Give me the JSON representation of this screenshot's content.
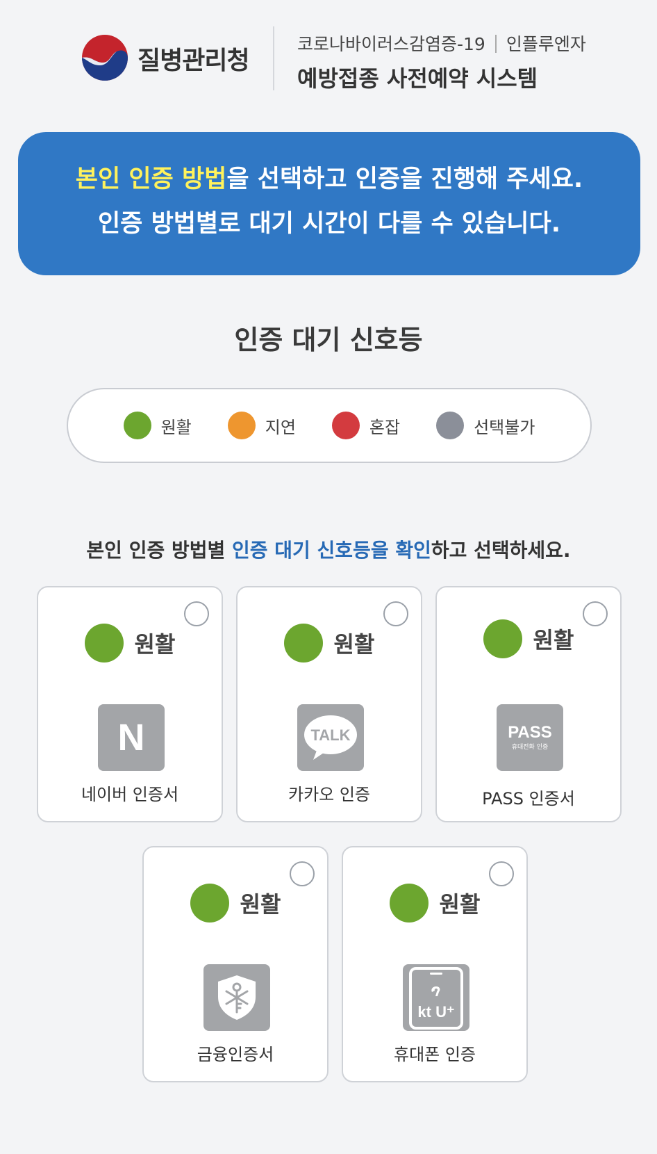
{
  "header": {
    "org_name": "질병관리청",
    "subtitle_left": "코로나바이러스감염증-19",
    "subtitle_right": "인플루엔자",
    "system_title": "예방접종 사전예약 시스템"
  },
  "banner": {
    "line1_highlight": "본인 인증 방법",
    "line1_rest": "을 선택하고 인증을 진행해 주세요.",
    "line2": "인증 방법별로 대기 시간이 다를 수 있습니다."
  },
  "signal": {
    "title": "인증 대기 신호등",
    "legend": [
      {
        "label": "원활",
        "color": "#6ca62f"
      },
      {
        "label": "지연",
        "color": "#ee962f"
      },
      {
        "label": "혼잡",
        "color": "#d33b3f"
      },
      {
        "label": "선택불가",
        "color": "#8b8f99"
      }
    ]
  },
  "guide": {
    "prefix": "본인 인증 방법별 ",
    "highlight": "인증 대기 신호등을 확인",
    "suffix": "하고 선택하세요."
  },
  "methods": [
    {
      "status": "원활",
      "status_color": "#6ca62f",
      "label": "네이버 인증서",
      "icon": "naver-icon",
      "icon_text": "N"
    },
    {
      "status": "원활",
      "status_color": "#6ca62f",
      "label": "카카오 인증",
      "icon": "kakao-talk-icon",
      "icon_text": "TALK"
    },
    {
      "status": "원활",
      "status_color": "#6ca62f",
      "label": "PASS 인증서",
      "icon": "pass-icon",
      "icon_text": "PASS",
      "icon_subtext": "휴대전화 인증"
    },
    {
      "status": "원활",
      "status_color": "#6ca62f",
      "label": "금융인증서",
      "icon": "financial-cert-icon"
    },
    {
      "status": "원활",
      "status_color": "#6ca62f",
      "label": "휴대폰 인증",
      "icon": "mobile-phone-icon",
      "icon_text": "kt U⁺"
    }
  ]
}
